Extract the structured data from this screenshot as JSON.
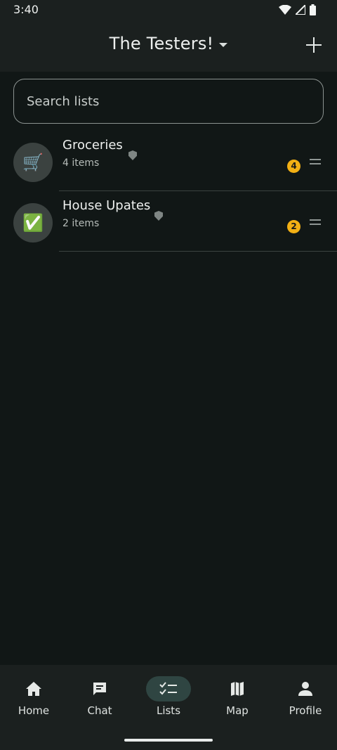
{
  "status_bar": {
    "time": "3:40"
  },
  "header": {
    "title": "The Testers!"
  },
  "search": {
    "placeholder": "Search lists"
  },
  "lists": [
    {
      "emoji": "🛒",
      "title": "Groceries",
      "subtitle": "4 items",
      "count": "4"
    },
    {
      "emoji": "✅",
      "title": "House Upates",
      "subtitle": "2 items",
      "count": "2"
    }
  ],
  "bottom_nav": [
    {
      "label": "Home",
      "icon": "home-icon"
    },
    {
      "label": "Chat",
      "icon": "chat-icon"
    },
    {
      "label": "Lists",
      "icon": "checklist-icon",
      "active": true
    },
    {
      "label": "Map",
      "icon": "map-icon"
    },
    {
      "label": "Profile",
      "icon": "person-icon"
    }
  ],
  "colors": {
    "accent_badge": "#f3b014",
    "active_pill": "#2f4542",
    "background": "#111716"
  }
}
